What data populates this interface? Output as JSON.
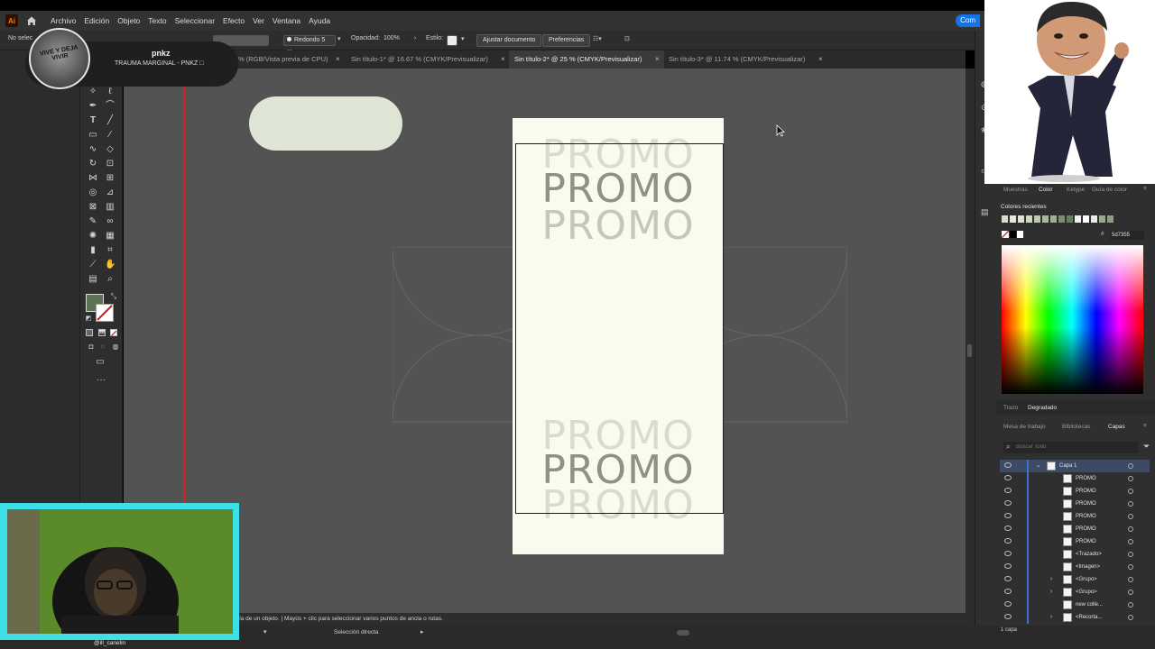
{
  "app": {
    "logo_text": "Ai",
    "menu": [
      "Archivo",
      "Edición",
      "Objeto",
      "Texto",
      "Seleccionar",
      "Efecto",
      "Ver",
      "Ventana",
      "Ayuda"
    ],
    "share_label": "Com"
  },
  "control_bar": {
    "selection_status": "No selec",
    "brush_label": "Redondo 5 ...",
    "opacity_label": "Opacidad:",
    "opacity_value": "100%",
    "style_label": "Estilo:",
    "align_button": "Ajustar documento",
    "prefs_button": "Preferencias"
  },
  "tabs": [
    {
      "label": "% (RGB/Vista previa de CPU)",
      "active": false
    },
    {
      "label": "Sin título-1* @ 16.67 % (CMYK/Previsualizar)",
      "active": false
    },
    {
      "label": "Sin título-2* @ 25 % (CMYK/Previsualizar)",
      "active": true
    },
    {
      "label": "Sin título-3* @ 11.74 % (CMYK/Previsualizar)",
      "active": false
    }
  ],
  "tab_close_glyph": "×",
  "artboard": {
    "promo_word": "PROMO",
    "pill_color": "#dfe5d4",
    "artboard_color": "#fafaee",
    "guide_color": "#d9282c"
  },
  "colors": {
    "fill_swatch": "#5d7355"
  },
  "status": {
    "hint": "cla de un objeto.  |  Mayús + clic para seleccionar varios puntos de ancla o rutas.",
    "tool_name": "Selección directa"
  },
  "right_panel": {
    "top_tabs": [
      "Muestras",
      "Color",
      "Ketype",
      "Guía de color"
    ],
    "recent_colors_label": "Colores recientes",
    "hex_value": "5d7355",
    "recent_swatches": [
      "#d9dccb",
      "#e6e8dc",
      "#dfe3d3",
      "#cfd6c0",
      "#bfcbb0",
      "#a9b89a",
      "#9fb090",
      "#7d8f70",
      "#6b7d60",
      "#f2f2f2",
      "#ffffff",
      "#e6ece0",
      "#9aab8a",
      "#8ea07e"
    ],
    "mid_tabs": [
      "Trazo",
      "Degradado"
    ],
    "lower_tabs": [
      "Mesa de trabajo",
      "Bibliotecas",
      "Capas"
    ],
    "search_placeholder": "Buscar Todo",
    "layers": [
      {
        "name": "Capa 1",
        "selected": true
      },
      {
        "name": "PROMO"
      },
      {
        "name": "PROMO"
      },
      {
        "name": "PROMO"
      },
      {
        "name": "PROMO"
      },
      {
        "name": "PROMO"
      },
      {
        "name": "PROMO"
      },
      {
        "name": "<Trazado>"
      },
      {
        "name": "<Imagen>"
      },
      {
        "name": "<Grupo>"
      },
      {
        "name": "<Grupo>"
      },
      {
        "name": "new colle..."
      },
      {
        "name": "<Recorta..."
      }
    ],
    "layer_count": "1 capa"
  },
  "overlay": {
    "user_name": "pnkz",
    "user_subtitle": "TRAUMA MARGINAL - PNKZ □",
    "avatar_text": "VIVE Y DEJA VIVIR",
    "webcam_handle": "@ill_canelin"
  }
}
